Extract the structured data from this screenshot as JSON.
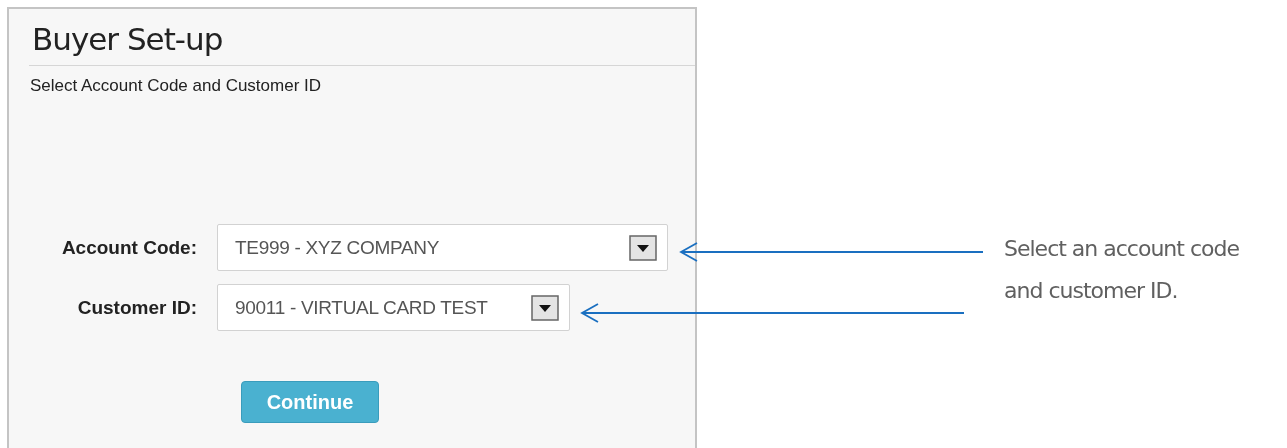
{
  "panel": {
    "title": "Buyer Set-up",
    "subtitle": "Select Account Code and Customer ID"
  },
  "fields": [
    {
      "label": "Account Code:",
      "value": "TE999 - XYZ COMPANY",
      "kind": "wide"
    },
    {
      "label": "Customer ID:",
      "value": "90011 - VIRTUAL CARD TEST",
      "kind": "narrow"
    }
  ],
  "button": {
    "label": "Continue"
  },
  "callout": {
    "text": "Select an account code and customer ID."
  }
}
